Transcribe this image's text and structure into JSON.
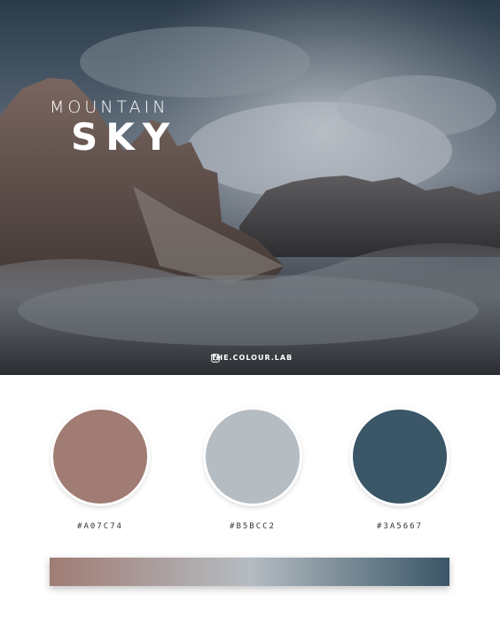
{
  "hero": {
    "title_top": "MOUNTAIN",
    "title_main": "SKY",
    "credit": "THE.COLOUR.LAB",
    "credit_icon": "instagram-icon"
  },
  "palette": [
    {
      "hex": "#A07C74",
      "label": "#A07C74"
    },
    {
      "hex": "#B5BCC2",
      "label": "#B5BCC2"
    },
    {
      "hex": "#3A5667",
      "label": "#3A5667"
    }
  ]
}
